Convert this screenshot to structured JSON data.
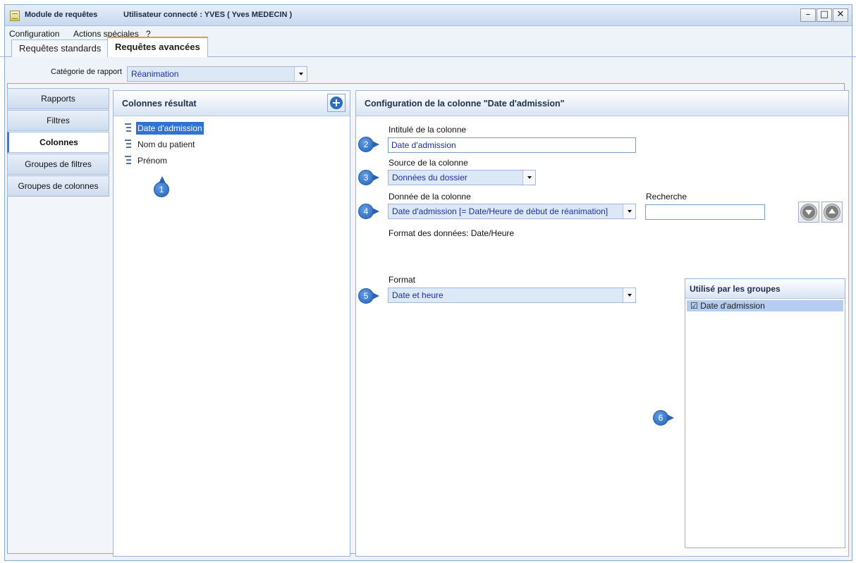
{
  "window": {
    "title": "Module de requêtes",
    "user_info": "Utilisateur connecté : YVES ( Yves MEDECIN )",
    "minimize": "–",
    "maximize": "□",
    "close": "✕"
  },
  "menu": {
    "configuration": "Configuration",
    "special_actions": "Actions spéciales",
    "help": "?"
  },
  "tabs": [
    {
      "label": "Requêtes standards"
    },
    {
      "label": "Requêtes avancées"
    }
  ],
  "category": {
    "label": "Catégorie de rapport",
    "value": "Réanimation"
  },
  "nav": [
    {
      "label": "Rapports"
    },
    {
      "label": "Filtres"
    },
    {
      "label": "Colonnes"
    },
    {
      "label": "Groupes de filtres"
    },
    {
      "label": "Groupes de colonnes"
    }
  ],
  "columns_panel": {
    "title": "Colonnes résultat",
    "items": [
      {
        "label": "Date d'admission"
      },
      {
        "label": "Nom du patient"
      },
      {
        "label": "Prénom"
      }
    ]
  },
  "config_panel": {
    "title": "Configuration de la colonne \"Date d'admission\"",
    "column_title_label": "Intitulé de la colonne",
    "column_title_value": "Date d'admission",
    "source_label": "Source de la colonne",
    "source_value": "Données du dossier",
    "data_label": "Donnée de la colonne",
    "data_value": "Date d'admission [= Date/Heure de début de réanimation]",
    "search_label": "Recherche",
    "search_value": "",
    "data_format_text": "Format des données: Date/Heure",
    "format_label": "Format",
    "format_value": "Date et heure"
  },
  "groups_panel": {
    "title": "Utilisé par les groupes",
    "checkbox": "☑",
    "item": "Date d'admission"
  },
  "badges": [
    "1",
    "2",
    "3",
    "4",
    "5",
    "6"
  ]
}
